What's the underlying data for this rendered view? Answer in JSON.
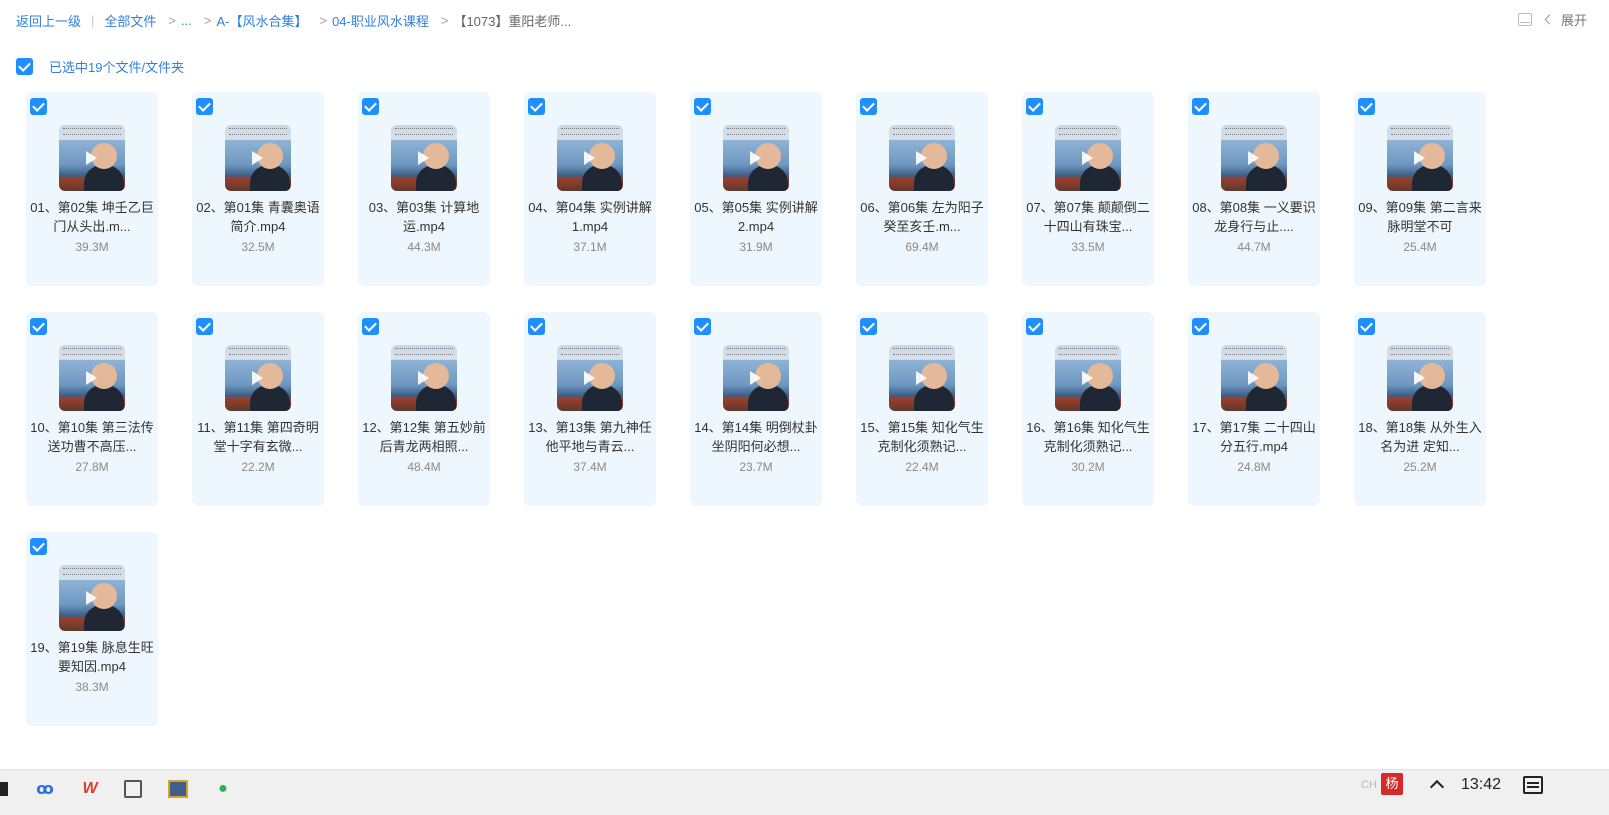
{
  "breadcrumb": {
    "back": "返回上一级",
    "all_files": "全部文件",
    "ellipsis": "...",
    "level1": "A-【风水合集】",
    "level2": "04-职业风水课程",
    "current": "【1073】重阳老师..."
  },
  "toolbar": {
    "expand_label": "展开",
    "layout_icon": "layout-icon",
    "expand_icon": "chevron-left-icon"
  },
  "selection": {
    "label": "已选中19个文件/文件夹",
    "all_checked": true
  },
  "files": [
    {
      "name": "01、第02集 坤壬乙巨门从头出.m...",
      "size": "39.3M"
    },
    {
      "name": "02、第01集 青囊奥语简介.mp4",
      "size": "32.5M"
    },
    {
      "name": "03、第03集 计算地运.mp4",
      "size": "44.3M"
    },
    {
      "name": "04、第04集 实例讲解1.mp4",
      "size": "37.1M"
    },
    {
      "name": "05、第05集 实例讲解2.mp4",
      "size": "31.9M"
    },
    {
      "name": "06、第06集 左为阳子癸至亥壬.m...",
      "size": "69.4M"
    },
    {
      "name": "07、第07集 颠颠倒二十四山有珠宝...",
      "size": "33.5M"
    },
    {
      "name": "08、第08集 一义要识龙身行与止....",
      "size": "44.7M"
    },
    {
      "name": "09、第09集 第二言来脉明堂不可",
      "size": "25.4M"
    },
    {
      "name": "10、第10集 第三法传送功曹不高压...",
      "size": "27.8M"
    },
    {
      "name": "11、第11集 第四奇明堂十字有玄微...",
      "size": "22.2M"
    },
    {
      "name": "12、第12集 第五妙前后青龙两相照...",
      "size": "48.4M"
    },
    {
      "name": "13、第13集 第九神任他平地与青云...",
      "size": "37.4M"
    },
    {
      "name": "14、第14集 明倒杖卦坐阴阳何必想...",
      "size": "23.7M"
    },
    {
      "name": "15、第15集 知化气生克制化须熟记...",
      "size": "22.4M"
    },
    {
      "name": "16、第16集 知化气生克制化须熟记...",
      "size": "30.2M"
    },
    {
      "name": "17、第17集 二十四山分五行.mp4",
      "size": "24.8M"
    },
    {
      "name": "18、第18集 从外生入名为进 定知...",
      "size": "25.2M"
    },
    {
      "name": "19、第19集 脉息生旺要知因.mp4",
      "size": "38.3M"
    }
  ],
  "taskbar": {
    "clock": "13:42",
    "tray_input": "CH",
    "tray_app": "杨",
    "icons": [
      "start-icon",
      "baidu-netdisk-icon",
      "wps-icon",
      "notes-icon",
      "finance-app-icon",
      "wechat-icon",
      "show-hidden-icons-icon",
      "notification-icon"
    ]
  },
  "colors": {
    "link": "#2f7fe0",
    "checkbox": "#1f8fff",
    "card_bg": "#eef7fe"
  }
}
